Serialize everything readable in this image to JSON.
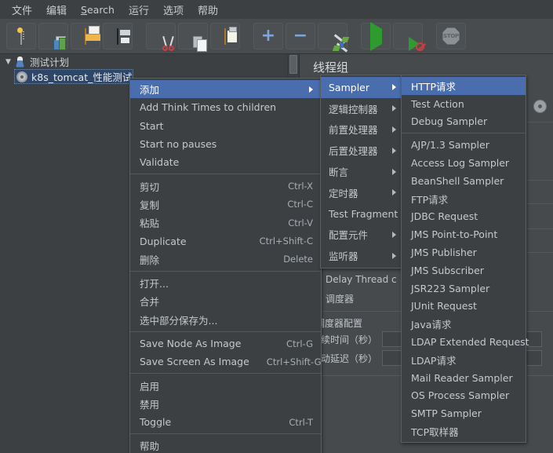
{
  "menubar": {
    "items": [
      {
        "label": "文件",
        "mnemonic": ""
      },
      {
        "label": "编辑",
        "mnemonic": ""
      },
      {
        "label": "Search",
        "mnemonic": "S"
      },
      {
        "label": "运行",
        "mnemonic": ""
      },
      {
        "label": "选项",
        "mnemonic": ""
      },
      {
        "label": "帮助",
        "mnemonic": ""
      }
    ]
  },
  "toolbar": {
    "buttons": [
      {
        "name": "new-icon",
        "title": "新建"
      },
      {
        "name": "templates-icon",
        "title": "模板"
      },
      {
        "name": "open-folder-icon",
        "title": "打开"
      },
      {
        "name": "save-icon",
        "title": "保存"
      },
      {
        "name": "cut-icon",
        "title": "剪切"
      },
      {
        "name": "copy-icon",
        "title": "复制"
      },
      {
        "name": "paste-icon",
        "title": "粘贴"
      },
      {
        "name": "plus-icon",
        "title": "展开全部"
      },
      {
        "name": "minus-icon",
        "title": "收起全部"
      },
      {
        "name": "toggle-icon",
        "title": "切换"
      },
      {
        "name": "start-icon",
        "title": "启动"
      },
      {
        "name": "start-no-pauses-icon",
        "title": "无间隔启动"
      },
      {
        "name": "stop-icon",
        "title": "停止",
        "glyph": "STOP"
      }
    ]
  },
  "tree": {
    "root": {
      "label": "测试计划",
      "expanded": true,
      "toggle": "▼"
    },
    "child": {
      "label": "k8s_tomcat_性能测试",
      "selected": true
    }
  },
  "right_panel": {
    "title": "线程组",
    "delay_thread_label": "Delay Thread c",
    "scheduler_label": "调度器",
    "scheduler_group_label": "调度器配置",
    "duration_label": "持续时间（秒）",
    "startup_delay_label": "启动延迟（秒）",
    "duration_value": "",
    "startup_delay_value": ""
  },
  "context_menu": {
    "items": [
      {
        "label": "添加",
        "accel": "",
        "submenu": true,
        "selected": true
      },
      {
        "label": "Add Think Times to children",
        "accel": "",
        "submenu": false
      },
      {
        "label": "Start",
        "accel": "",
        "submenu": false
      },
      {
        "label": "Start no pauses",
        "accel": "",
        "submenu": false
      },
      {
        "label": "Validate",
        "accel": "",
        "submenu": false
      },
      {
        "separator": true
      },
      {
        "label": "剪切",
        "accel": "Ctrl-X",
        "submenu": false
      },
      {
        "label": "复制",
        "accel": "Ctrl-C",
        "submenu": false
      },
      {
        "label": "粘贴",
        "accel": "Ctrl-V",
        "submenu": false
      },
      {
        "label": "Duplicate",
        "accel": "Ctrl+Shift-C",
        "submenu": false
      },
      {
        "label": "删除",
        "accel": "Delete",
        "submenu": false
      },
      {
        "separator": true
      },
      {
        "label": "打开...",
        "accel": "",
        "submenu": false
      },
      {
        "label": "合并",
        "accel": "",
        "submenu": false
      },
      {
        "label": "选中部分保存为...",
        "accel": "",
        "submenu": false
      },
      {
        "separator": true
      },
      {
        "label": "Save Node As Image",
        "accel": "Ctrl-G",
        "submenu": false
      },
      {
        "label": "Save Screen As Image",
        "accel": "Ctrl+Shift-G",
        "submenu": false
      },
      {
        "separator": true
      },
      {
        "label": "启用",
        "accel": "",
        "submenu": false
      },
      {
        "label": "禁用",
        "accel": "",
        "submenu": false
      },
      {
        "label": "Toggle",
        "accel": "Ctrl-T",
        "submenu": false
      },
      {
        "separator": true
      },
      {
        "label": "帮助",
        "accel": "",
        "submenu": false
      }
    ]
  },
  "add_submenu": {
    "items": [
      {
        "label": "Sampler",
        "submenu": true,
        "selected": true
      },
      {
        "label": "逻辑控制器",
        "submenu": true
      },
      {
        "label": "前置处理器",
        "submenu": true
      },
      {
        "label": "后置处理器",
        "submenu": true
      },
      {
        "label": "断言",
        "submenu": true
      },
      {
        "label": "定时器",
        "submenu": true
      },
      {
        "label": "Test Fragment",
        "submenu": true
      },
      {
        "label": "配置元件",
        "submenu": true
      },
      {
        "label": "监听器",
        "submenu": true
      }
    ]
  },
  "sampler_submenu": {
    "items": [
      {
        "label": "HTTP请求",
        "selected": true
      },
      {
        "label": "Test Action"
      },
      {
        "label": "Debug Sampler"
      },
      {
        "separator": true
      },
      {
        "label": "AJP/1.3 Sampler"
      },
      {
        "label": "Access Log Sampler"
      },
      {
        "label": "BeanShell Sampler"
      },
      {
        "label": "FTP请求"
      },
      {
        "label": "JDBC Request"
      },
      {
        "label": "JMS Point-to-Point"
      },
      {
        "label": "JMS Publisher"
      },
      {
        "label": "JMS Subscriber"
      },
      {
        "label": "JSR223 Sampler"
      },
      {
        "label": "JUnit Request"
      },
      {
        "label": "Java请求"
      },
      {
        "label": "LDAP Extended Request"
      },
      {
        "label": "LDAP请求"
      },
      {
        "label": "Mail Reader Sampler"
      },
      {
        "label": "OS Process Sampler"
      },
      {
        "label": "SMTP Sampler"
      },
      {
        "label": "TCP取样器"
      }
    ]
  },
  "colors": {
    "menu_highlight": "#4a6ead",
    "tree_selection": "#2e4668",
    "panel_bg": "#464a4d",
    "menu_bg": "#3c4043",
    "text": "#c5c9cc"
  }
}
